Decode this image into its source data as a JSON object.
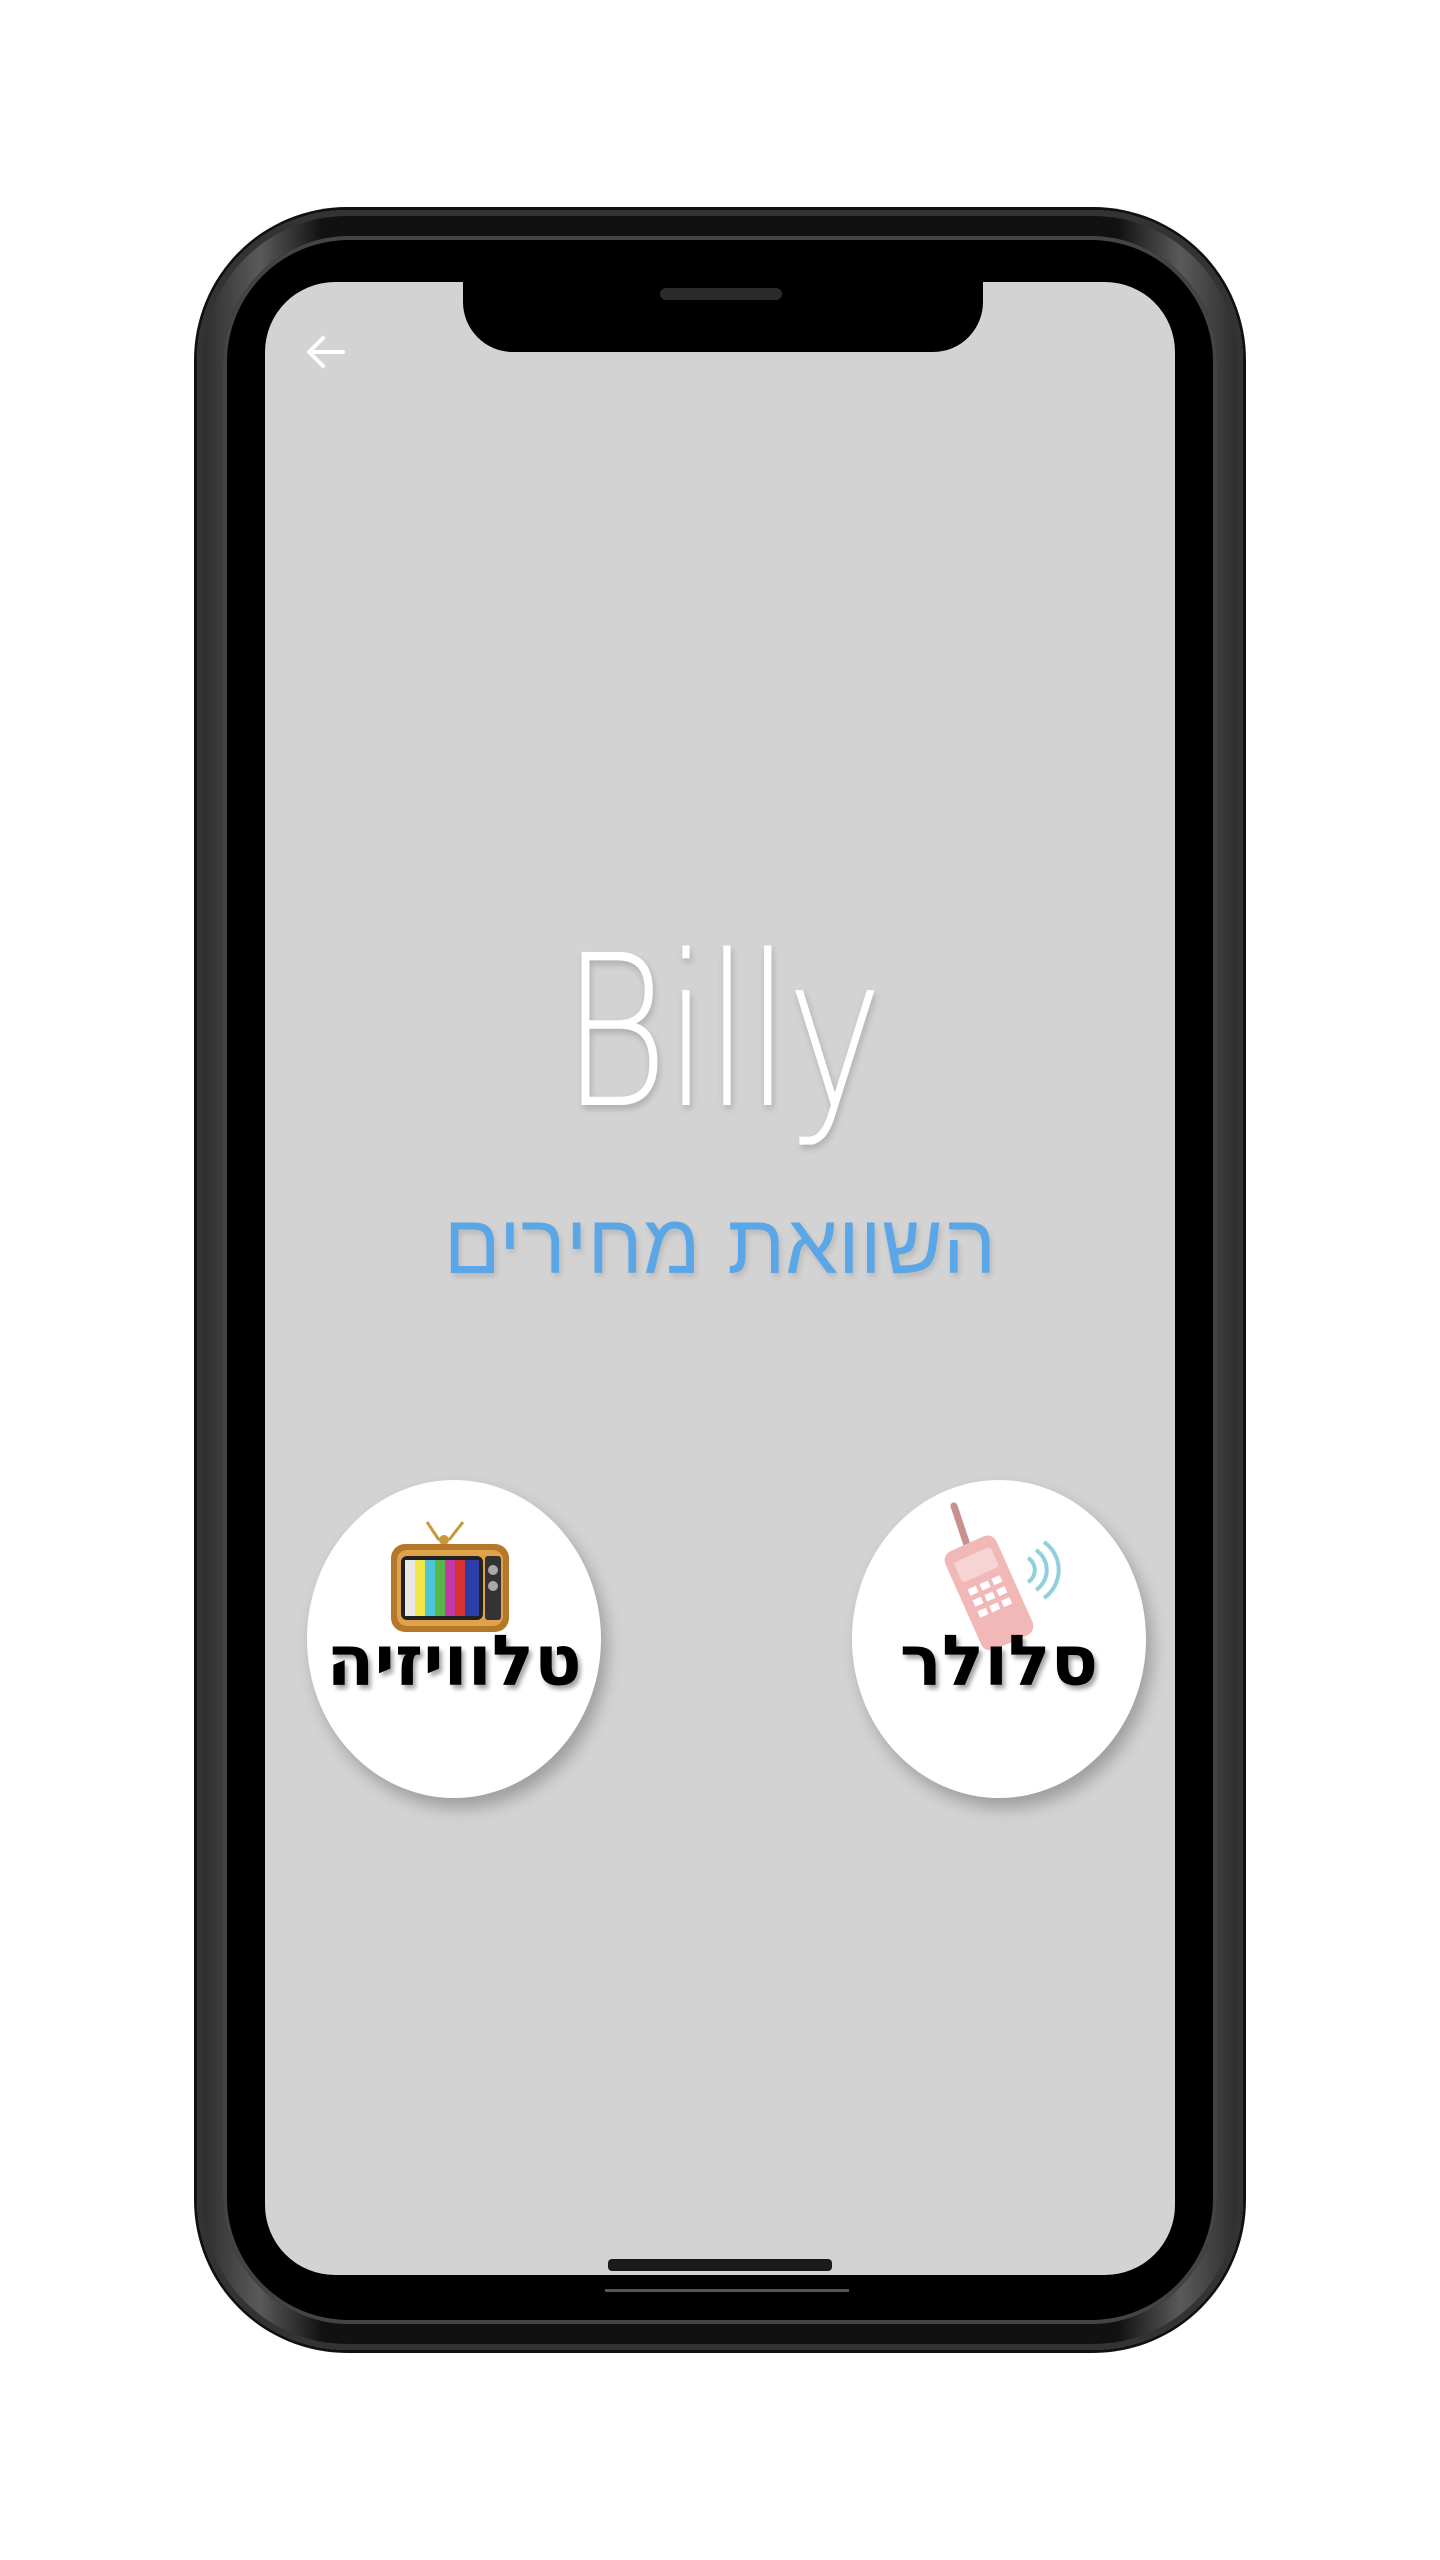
{
  "app": {
    "title": "Billy",
    "subtitle": "השוואת מחירים"
  },
  "navigation": {
    "back_icon": "arrow-left-icon"
  },
  "categories": [
    {
      "label": "טלוויזיה",
      "icon": "tv-icon"
    },
    {
      "label": "סלולר",
      "icon": "cellphone-icon"
    }
  ],
  "colors": {
    "screen_background": "#d3d3d3",
    "subtitle": "#5aa6e6",
    "title": "#ffffff",
    "button_background": "#ffffff"
  }
}
